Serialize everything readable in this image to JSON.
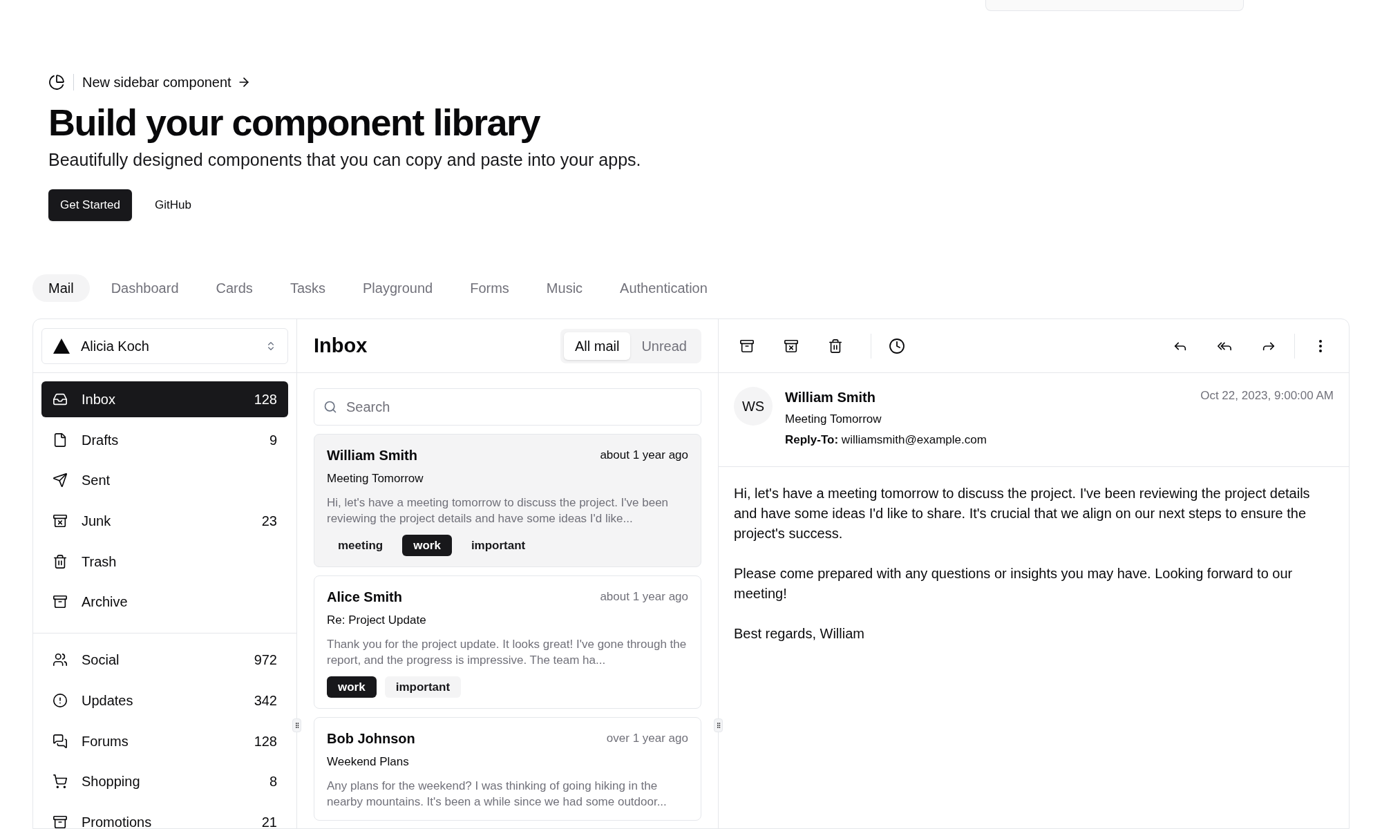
{
  "announcement": {
    "text": "New sidebar component"
  },
  "hero": {
    "title": "Build your component library",
    "subtitle": "Beautifully designed components that you can copy and paste into your apps.",
    "buttons": [
      {
        "label": "Get Started",
        "kind": "primary"
      },
      {
        "label": "GitHub",
        "kind": "ghost"
      }
    ]
  },
  "example_tabs": [
    {
      "label": "Mail",
      "selected": true
    },
    {
      "label": "Dashboard",
      "selected": false
    },
    {
      "label": "Cards",
      "selected": false
    },
    {
      "label": "Tasks",
      "selected": false
    },
    {
      "label": "Playground",
      "selected": false
    },
    {
      "label": "Forms",
      "selected": false
    },
    {
      "label": "Music",
      "selected": false
    },
    {
      "label": "Authentication",
      "selected": false
    }
  ],
  "account": {
    "name": "Alicia Koch"
  },
  "sidebar": {
    "groups": [
      {
        "items": [
          {
            "label": "Inbox",
            "count": "128",
            "selected": true
          },
          {
            "label": "Drafts",
            "count": "9",
            "selected": false
          },
          {
            "label": "Sent",
            "selected": false
          },
          {
            "label": "Junk",
            "count": "23",
            "selected": false
          },
          {
            "label": "Trash",
            "selected": false
          },
          {
            "label": "Archive",
            "selected": false
          }
        ]
      },
      {
        "items": [
          {
            "label": "Social",
            "count": "972",
            "selected": false
          },
          {
            "label": "Updates",
            "count": "342",
            "selected": false
          },
          {
            "label": "Forums",
            "count": "128",
            "selected": false
          },
          {
            "label": "Shopping",
            "count": "8",
            "selected": false
          },
          {
            "label": "Promotions",
            "count": "21",
            "selected": false
          }
        ]
      }
    ]
  },
  "mail_list": {
    "title": "Inbox",
    "filters": [
      {
        "label": "All mail",
        "selected": true
      },
      {
        "label": "Unread",
        "selected": false
      }
    ],
    "search": {
      "placeholder": "Search"
    },
    "items": [
      {
        "from": "William Smith",
        "time": "about 1 year ago",
        "subject": "Meeting Tomorrow",
        "preview": "Hi, let's have a meeting tomorrow to discuss the project. I've been reviewing the project details and have some ideas I'd like...",
        "selected": true,
        "tags": [
          {
            "label": "meeting",
            "kind": "secondary"
          },
          {
            "label": "work",
            "kind": "default"
          },
          {
            "label": "important",
            "kind": "secondary"
          }
        ]
      },
      {
        "from": "Alice Smith",
        "time": "about 1 year ago",
        "subject": "Re: Project Update",
        "preview": "Thank you for the project update. It looks great! I've gone through the report, and the progress is impressive. The team ha...",
        "selected": false,
        "tags": [
          {
            "label": "work",
            "kind": "default"
          },
          {
            "label": "important",
            "kind": "secondary"
          }
        ]
      },
      {
        "from": "Bob Johnson",
        "time": "over 1 year ago",
        "subject": "Weekend Plans",
        "preview": "Any plans for the weekend? I was thinking of going hiking in the nearby mountains. It's been a while since we had some outdoor...",
        "selected": false
      }
    ]
  },
  "message": {
    "initials": "WS",
    "from": "William Smith",
    "subject": "Meeting Tomorrow",
    "reply_to": "**Reply-To:** williamsmith@example.com",
    "date": "Oct 22, 2023, 9:00:00 AM",
    "body": [
      "Hi, let's have a meeting tomorrow to discuss the project. I've been reviewing the project details and have some ideas I'd like to share. It's crucial that we align on our next steps to ensure the project's success.",
      "Please come prepared with any questions or insights you may have. Looking forward to our meeting!",
      "Best regards, William"
    ]
  }
}
